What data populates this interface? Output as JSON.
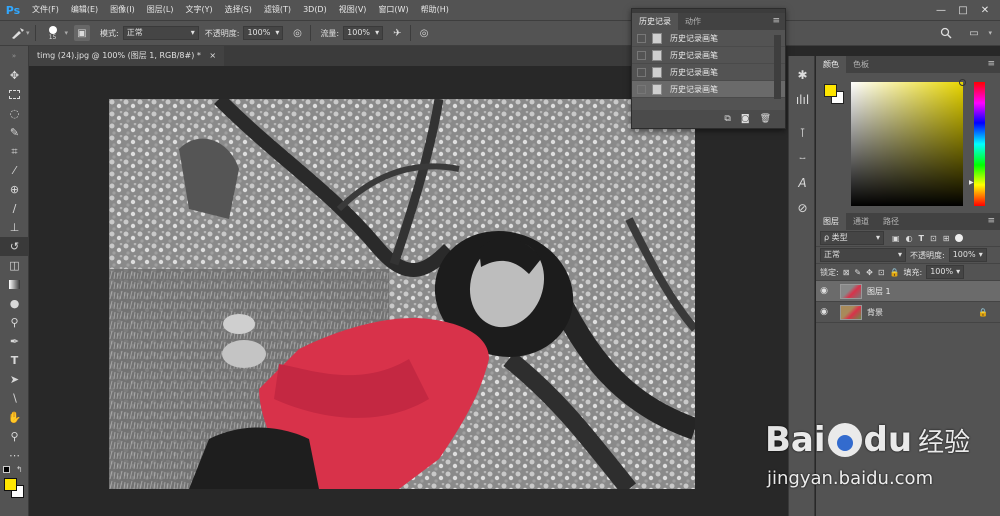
{
  "app": {
    "logo": "Ps"
  },
  "menu": [
    "文件(F)",
    "编辑(E)",
    "图像(I)",
    "图层(L)",
    "文字(Y)",
    "选择(S)",
    "滤镜(T)",
    "3D(D)",
    "视图(V)",
    "窗口(W)",
    "帮助(H)"
  ],
  "window_controls": {
    "minimize": "—",
    "maximize": "□",
    "close": "✕"
  },
  "options": {
    "brush_size": "15",
    "mode_label": "模式:",
    "mode_value": "正常",
    "opacity_label": "不透明度:",
    "opacity_value": "100%",
    "flow_label": "流量:",
    "flow_value": "100%"
  },
  "document": {
    "tab_title": "timg (24).jpg @ 100% (图层 1, RGB/8#) *",
    "close": "×"
  },
  "history_panel": {
    "tabs": [
      "历史记录",
      "动作"
    ],
    "rows": [
      "历史记录画笔",
      "历史记录画笔",
      "历史记录画笔",
      "历史记录画笔"
    ],
    "selected_index": 3
  },
  "color_panel": {
    "tabs": [
      "颜色",
      "色板"
    ],
    "foreground": "#ffe600",
    "background": "#ffffff"
  },
  "layers_panel": {
    "tabs": [
      "图层",
      "通道",
      "路径"
    ],
    "filter_label": "ρ 类型",
    "blend_mode": "正常",
    "opacity_label": "不透明度:",
    "opacity_value": "100%",
    "lock_label": "锁定:",
    "fill_label": "填充:",
    "fill_value": "100%",
    "layers": [
      {
        "name": "图层 1",
        "selected": true
      },
      {
        "name": "背景",
        "locked": true
      }
    ]
  },
  "watermark": {
    "brand": "Bai",
    "brand_suffix": "du",
    "cn": "经验",
    "url": "jingyan.baidu.com"
  },
  "colors": {
    "accent": "#31a8ff",
    "panel": "#535353",
    "dark": "#282828",
    "photo_red": "#d8324a"
  }
}
